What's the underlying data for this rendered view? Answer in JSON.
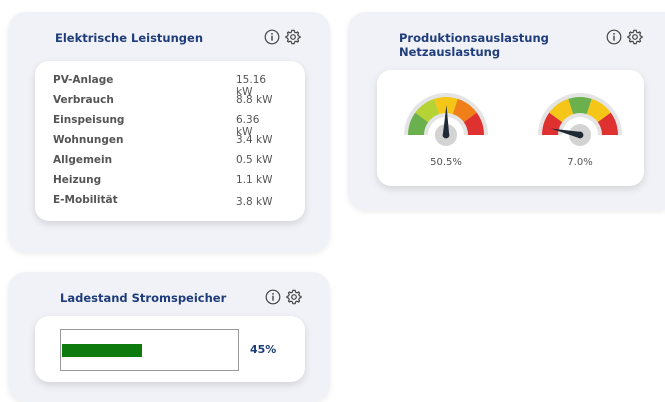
{
  "power": {
    "title": "Elektrische Leistungen",
    "rows": [
      {
        "label": "PV-Anlage",
        "value": "15.16 kW"
      },
      {
        "label": "Verbrauch",
        "value": "8.8 kW"
      },
      {
        "label": "Einspeisung",
        "value": "6.36 kW"
      },
      {
        "label": "Wohnungen",
        "value": "3.4 kW"
      },
      {
        "label": "Allgemein",
        "value": "0.5 kW"
      },
      {
        "label": "Heizung",
        "value": "1.1 kW"
      },
      {
        "label": "E-Mobilität",
        "value": "3.8 kW"
      }
    ]
  },
  "utilization": {
    "title_line1": "Produktionsauslastung",
    "title_line2": "Netzauslastung",
    "gauges": [
      {
        "value_text": "50.5%",
        "value": 50.5,
        "colors": [
          "#6ab04c",
          "#b5d334",
          "#f5c518",
          "#f07f1a",
          "#e03131"
        ]
      },
      {
        "value_text": "7.0%",
        "value": 7.0,
        "colors": [
          "#e03131",
          "#f5c518",
          "#6ab04c",
          "#f5c518",
          "#e03131"
        ]
      }
    ]
  },
  "storage": {
    "title": "Ladestand Stromspeicher",
    "percent_text": "45%",
    "level": 0.45,
    "bar_color": "#0c7a0c"
  },
  "icons": {
    "info": "info-icon",
    "settings": "gear-icon"
  },
  "colors": {
    "accent": "#1f3d7a",
    "panel_bg": "#f1f2f7"
  }
}
